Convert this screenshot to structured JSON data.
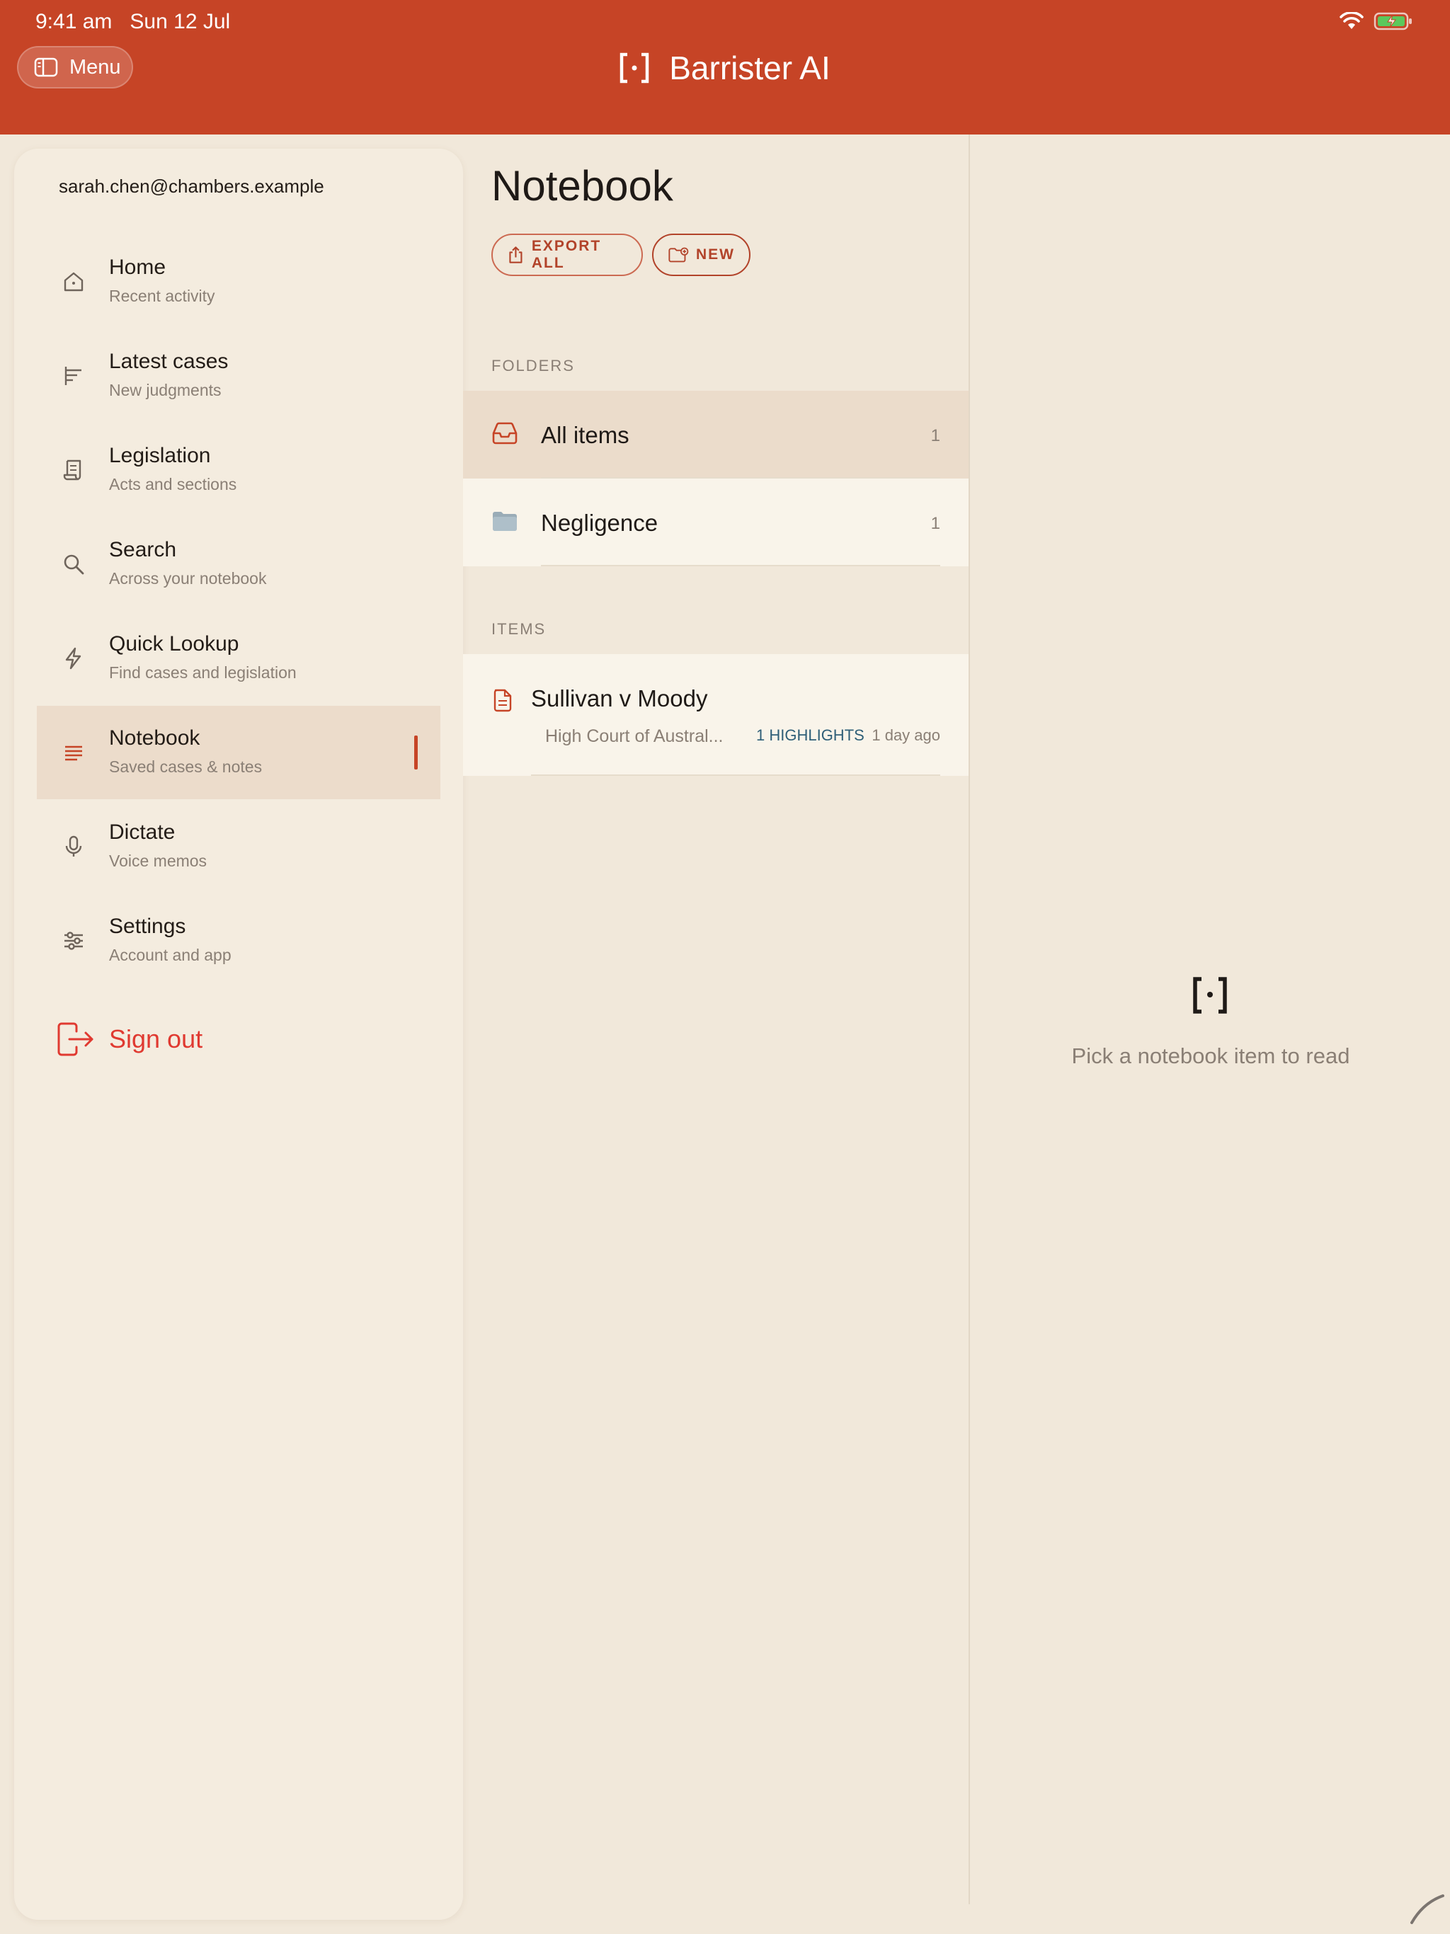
{
  "status_bar": {
    "time": "9:41 am",
    "date": "Sun 12 Jul"
  },
  "header": {
    "menu_label": "Menu",
    "app_name": "Barrister AI"
  },
  "sidebar": {
    "email": "sarah.chen@chambers.example",
    "items": [
      {
        "label": "Home",
        "sub": "Recent activity",
        "icon": "home-icon"
      },
      {
        "label": "Latest cases",
        "sub": "New judgments",
        "icon": "latest-cases-icon"
      },
      {
        "label": "Legislation",
        "sub": "Acts and sections",
        "icon": "scroll-icon"
      },
      {
        "label": "Search",
        "sub": "Across your notebook",
        "icon": "search-icon"
      },
      {
        "label": "Quick Lookup",
        "sub": "Find cases and legislation",
        "icon": "lightning-icon"
      },
      {
        "label": "Notebook",
        "sub": "Saved cases & notes",
        "icon": "notebook-icon",
        "active": true
      },
      {
        "label": "Dictate",
        "sub": "Voice memos",
        "icon": "microphone-icon"
      },
      {
        "label": "Settings",
        "sub": "Account and app",
        "icon": "sliders-icon"
      }
    ],
    "sign_out": "Sign out"
  },
  "notebook": {
    "title": "Notebook",
    "export_label": "EXPORT ALL",
    "new_label": "NEW",
    "folders_heading": "FOLDERS",
    "folders": [
      {
        "name": "All items",
        "count": "1"
      },
      {
        "name": "Negligence",
        "count": "1"
      }
    ],
    "items_heading": "ITEMS",
    "items": [
      {
        "title": "Sullivan v Moody",
        "court": "High Court of Austral...",
        "highlights": "1 HIGHLIGHTS",
        "time": "1 day ago"
      }
    ]
  },
  "reader": {
    "empty_message": "Pick a notebook item to read"
  },
  "colors": {
    "brand": "#c64426",
    "background": "#f1e8da",
    "danger": "#e03a31",
    "highlight_text": "#2f5f78"
  }
}
